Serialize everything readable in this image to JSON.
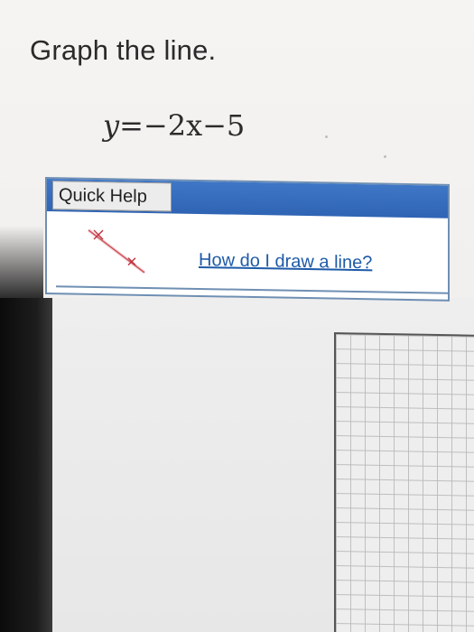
{
  "question": {
    "instruction": "Graph the line.",
    "equation": {
      "lhs": "y",
      "rhs": "=−2x−5"
    }
  },
  "quick_help": {
    "tab_label": "Quick Help",
    "link_text": "How do I draw a line?",
    "icon": "line-drawing-icon"
  },
  "graph": {
    "icon": "grid"
  },
  "colors": {
    "help_bar": "#3f77c6",
    "help_border": "#6f8fb3",
    "link": "#1e5aa8",
    "icon_line": "#c0303a"
  }
}
